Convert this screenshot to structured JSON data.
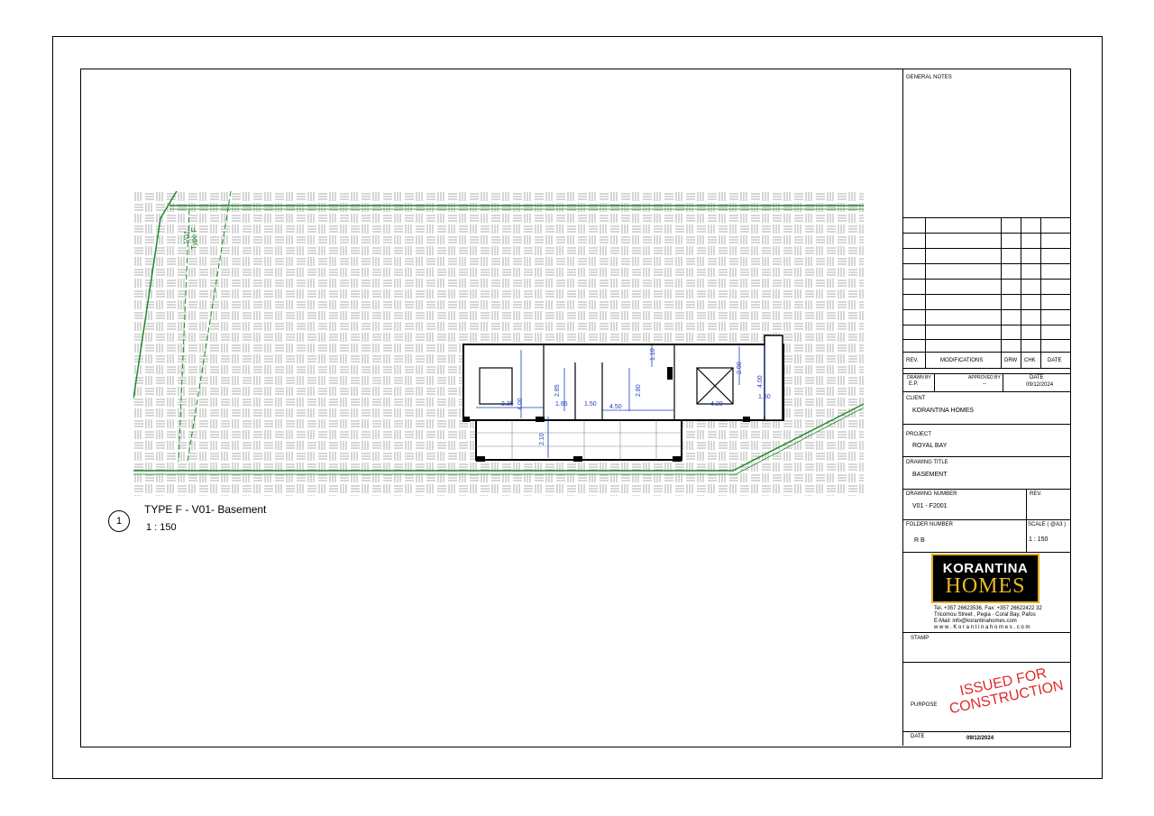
{
  "plan": {
    "number": "1",
    "title": "TYPE F - V01- Basement",
    "scale": "1 : 150",
    "grid_label_1": "V01",
    "grid_label_2": "Type F",
    "dimensions": [
      "4.00",
      "3.35",
      "2.85",
      "1.65",
      "1.50",
      "2.80",
      "4.50",
      "1.10",
      "2.00",
      "4.00",
      "4.20",
      "1.60",
      "2.10"
    ]
  },
  "title_block": {
    "general_notes_label": "GENERAL NOTES",
    "rev_label": "REV.",
    "modifications_label": "MODIFICATIONS",
    "drw_label": "DRW",
    "chk_label": "CHK",
    "date_label": "DATE",
    "drawn_by_label": "DRAWN BY",
    "drawn_by": "E.P.",
    "approved_by_label": "APPROVED BY",
    "approved_by": "--",
    "date_header": "DATE",
    "date": "09/12/2024",
    "client_label": "CLIENT",
    "client": "KORANTINA HOMES",
    "project_label": "PROJECT",
    "project": "ROYAL BAY",
    "drawing_title_label": "DRAWING TITLE",
    "drawing_title": "BASEMENT",
    "drawing_number_label": "DRAWING NUMBER",
    "drawing_number": "V01 - F2001",
    "rev_label_2": "REV.",
    "folder_number_label": "FOLDER NUMBER",
    "folder_number": "R B",
    "scale_label": "SCALE ( @A3 )",
    "scale": "1 : 150",
    "stamp_label": "STAMP",
    "purpose_label": "PURPOSE",
    "purpose_line1": "ISSUED FOR",
    "purpose_line2": "CONSTRUCTION",
    "date_footer_label": "DATE",
    "date_footer": "09/12/2024"
  },
  "logo": {
    "line1": "KORANTINA",
    "line2": "HOMES",
    "tel": "Tel. +357 26623536, Fax: +357 26622422 32",
    "address": "Tricomou Street , Pegia - Coral Bay, Pafos",
    "email": "E-Mail: info@korantinahomes.com",
    "web": "w w w . K o r a n t i n a h o m e s . c o m"
  },
  "colors": {
    "line": "#000000",
    "site_boundary": "#1a8a2a",
    "dimension": "#1f3fbf",
    "stamp": "#e02a2a",
    "logo_gold": "#e8b82a"
  }
}
